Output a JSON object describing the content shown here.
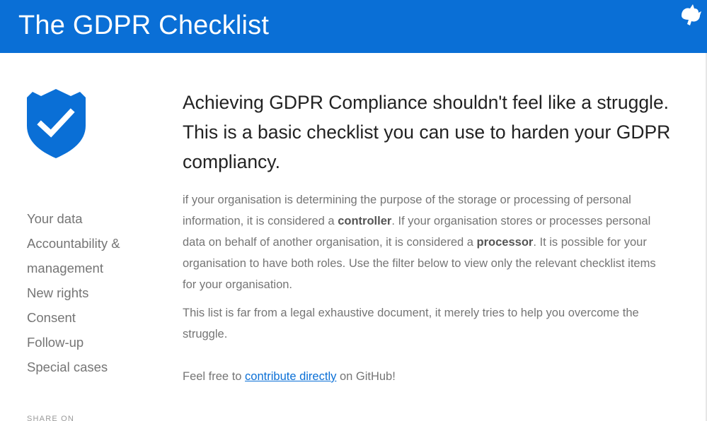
{
  "header": {
    "title": "The GDPR Checklist",
    "background_color": "#0a6fd6",
    "corner_icon": "github-octocat-icon"
  },
  "sidebar": {
    "logo_icon": "shield-check-icon",
    "nav_items": [
      {
        "label": "Your data"
      },
      {
        "label": "Accountability &"
      },
      {
        "label": "management"
      },
      {
        "label": "New rights"
      },
      {
        "label": "Consent"
      },
      {
        "label": "Follow-up"
      },
      {
        "label": "Special cases"
      }
    ],
    "share_label": "SHARE ON"
  },
  "main": {
    "lead": "Achieving GDPR Compliance shouldn't feel like a struggle. This is a basic checklist you can use to harden your GDPR compliancy.",
    "intro": {
      "part1": "if your organisation is determining the purpose of the storage or processing of personal information, it is considered a ",
      "controller": "controller",
      "part2": ". If your organisation stores or processes personal data on behalf of another organisation, it is considered a ",
      "processor": "processor",
      "part3": ". It is possible for your organisation to have both roles. Use the filter below to view only the relevant checklist items for your organisation."
    },
    "disclaimer": "This list is far from a legal exhaustive document, it merely tries to help you overcome the struggle.",
    "contribute": {
      "prefix": "Feel free to ",
      "link_text": "contribute directly",
      "suffix": " on GitHub!"
    },
    "accent_color": "#0a6fd6"
  }
}
